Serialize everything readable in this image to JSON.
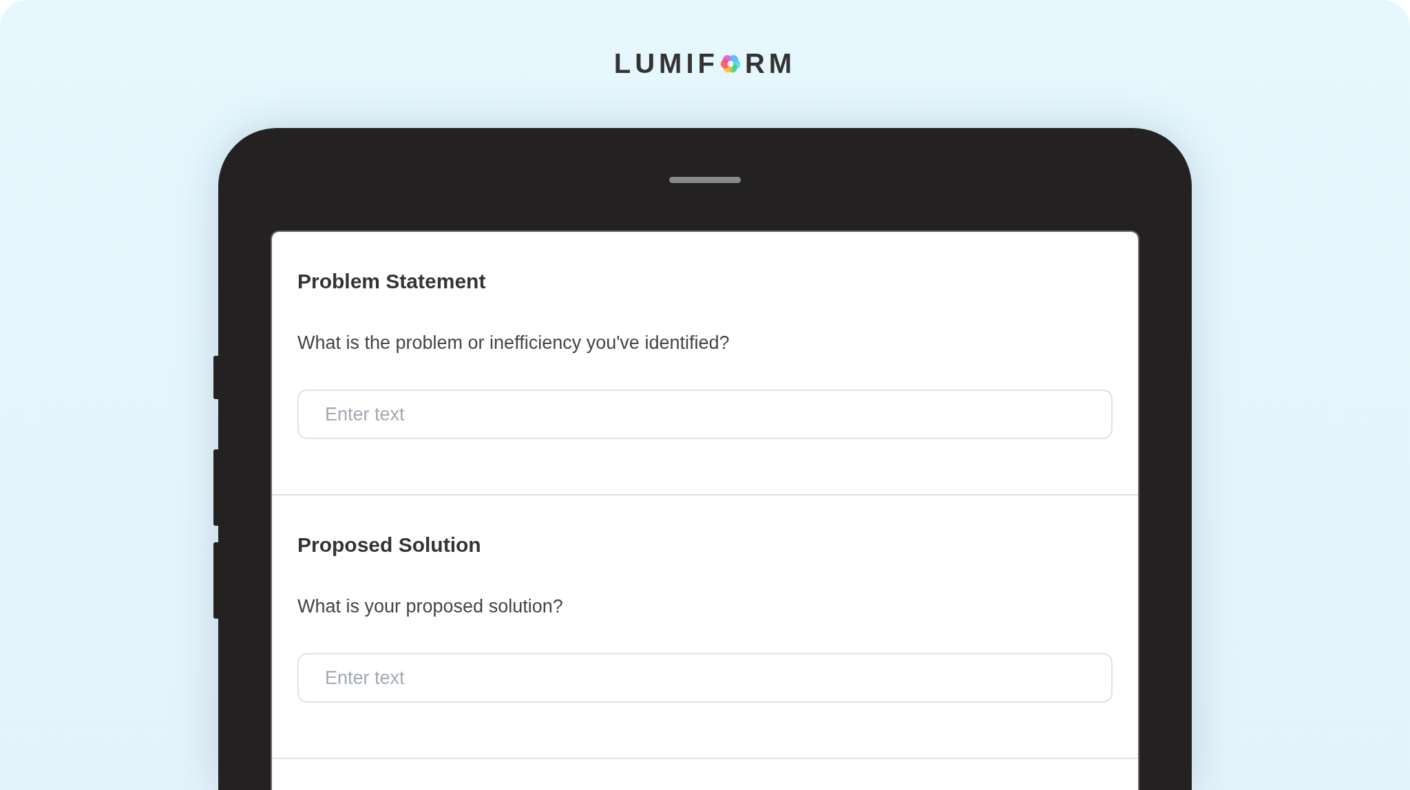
{
  "logo": {
    "text_before_icon": "LUMIF",
    "text_after_icon": "RM"
  },
  "sections": [
    {
      "title": "Problem Statement",
      "question": "What is the problem or inefficiency you've identified?",
      "field": {
        "placeholder": "Enter text"
      }
    },
    {
      "title": "Proposed Solution",
      "question": "What is your proposed solution?",
      "field": {
        "placeholder": "Enter text"
      }
    }
  ]
}
